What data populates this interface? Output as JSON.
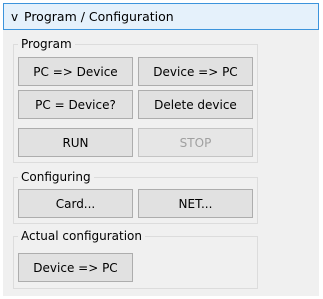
{
  "panel": {
    "chevron": "v",
    "title": "Program / Configuration"
  },
  "program": {
    "legend": "Program",
    "pc_to_device": "PC => Device",
    "device_to_pc": "Device => PC",
    "pc_equals_device": "PC = Device?",
    "delete_device": "Delete device",
    "run": "RUN",
    "stop": "STOP"
  },
  "configuring": {
    "legend": "Configuring",
    "card": "Card...",
    "net": "NET..."
  },
  "actual_configuration": {
    "legend": "Actual configuration",
    "device_to_pc": "Device => PC"
  }
}
